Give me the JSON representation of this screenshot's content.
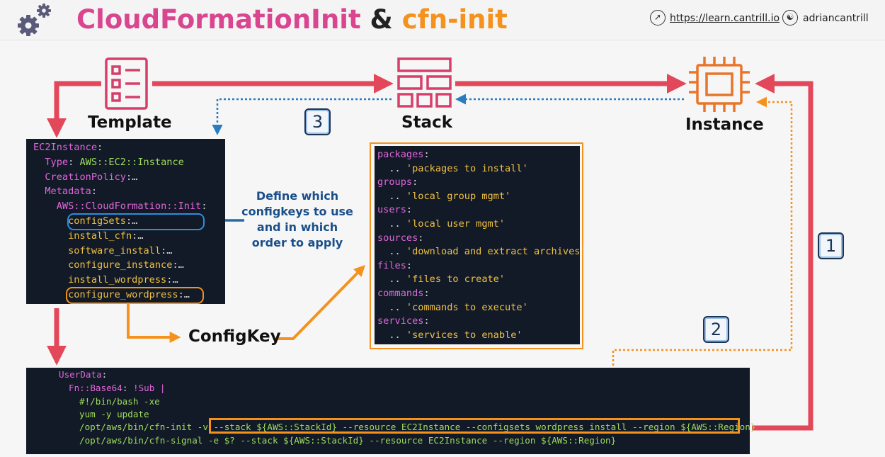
{
  "header": {
    "title_part1": "CloudFormationInit",
    "title_amp": "&",
    "title_part2": "cfn-init",
    "url": "https://learn.cantrill.io",
    "handle": "adriancantrill",
    "icons": [
      "gear-icon",
      "compass-icon",
      "twitter-icon"
    ]
  },
  "colors": {
    "magenta": "#d9468f",
    "orange": "#f5921e",
    "red_arrow": "#e3475a",
    "blue_dotted": "#2a7bbf",
    "code_bg": "#121a28"
  },
  "labels": {
    "template": "Template",
    "stack": "Stack",
    "instance": "Instance",
    "configkey": "ConfigKey"
  },
  "annotation": "Define which configkeys to use and in which order  to apply",
  "steps": [
    "1",
    "2",
    "3"
  ],
  "template_code": [
    {
      "indent": "",
      "key": "EC2Instance",
      "sep": ":",
      "val": ""
    },
    {
      "indent": "  ",
      "key": "Type",
      "sep": ": ",
      "val": "AWS::EC2::Instance"
    },
    {
      "indent": "  ",
      "key": "CreationPolicy",
      "sep": ":",
      "val": "…"
    },
    {
      "indent": "  ",
      "key": "Metadata",
      "sep": ":",
      "val": ""
    },
    {
      "indent": "    ",
      "key": "AWS::CloudFormation::Init",
      "sep": ":",
      "val": ""
    },
    {
      "indent": "      ",
      "key": "configSets",
      "sep": ":",
      "val": "…"
    },
    {
      "indent": "      ",
      "key": "install_cfn",
      "sep": ":",
      "val": "…"
    },
    {
      "indent": "      ",
      "key": "software_install",
      "sep": ":",
      "val": "…"
    },
    {
      "indent": "      ",
      "key": "configure_instance",
      "sep": ":",
      "val": "…"
    },
    {
      "indent": "      ",
      "key": "install_wordpress",
      "sep": ":",
      "val": "…"
    },
    {
      "indent": "      ",
      "key": "configure_wordpress",
      "sep": ":",
      "val": "…"
    }
  ],
  "configkey_code": [
    {
      "key": "packages",
      "val": "'packages to install'"
    },
    {
      "key": "groups",
      "val": "'local group mgmt'"
    },
    {
      "key": "users",
      "val": "'local user mgmt'"
    },
    {
      "key": "sources",
      "val": "'download and extract archives'"
    },
    {
      "key": "files",
      "val": "'files to create'"
    },
    {
      "key": "commands",
      "val": "'commands to execute'"
    },
    {
      "key": "services",
      "val": "'services to enable'"
    }
  ],
  "userdata": {
    "line1_key": "UserData",
    "line2_key": "Fn::Base64",
    "line2_val": "!Sub |",
    "line3": "#!/bin/bash -xe",
    "line4": "yum -y update",
    "line5_cmd": "/opt/aws/bin/cfn-init -v ",
    "line5_args": "--stack ${AWS::StackId} --resource EC2Instance --configsets wordpress_install --region ${AWS::Region}",
    "line6": "/opt/aws/bin/cfn-signal -e $? --stack ${AWS::StackId} --resource EC2Instance --region ${AWS::Region}"
  }
}
